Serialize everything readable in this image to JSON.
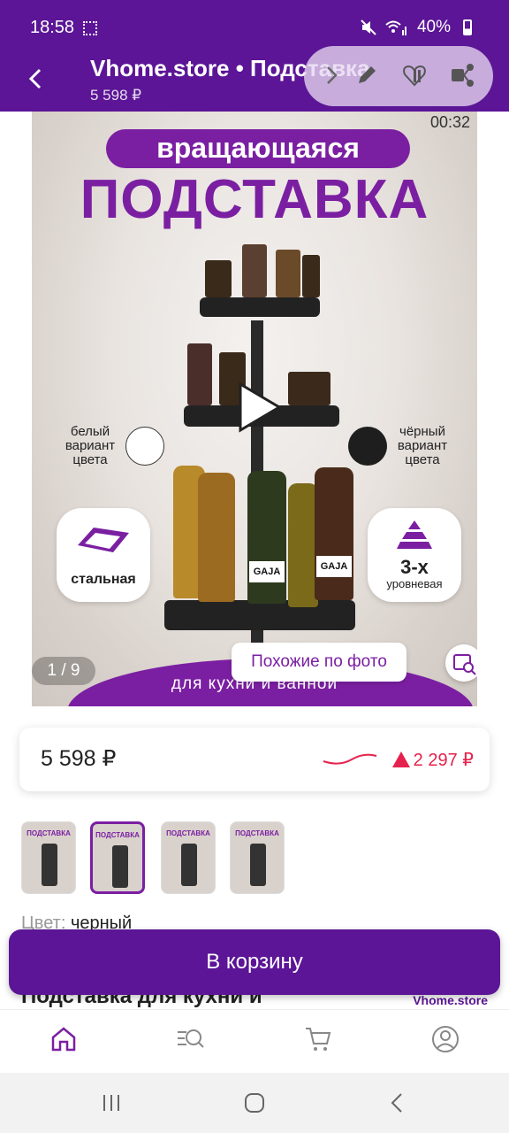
{
  "status": {
    "time": "18:58",
    "battery": "40%"
  },
  "header": {
    "title": "Vhome.store • Подставка для кухни и ванной",
    "price": "5 598 ₽"
  },
  "media": {
    "timer": "00:32",
    "pill_text": "вращающаяся",
    "big_title": "ПОДСТАВКА",
    "white_variant": "белый вариант цвета",
    "black_variant": "чёрный вариант цвета",
    "badge_left": "стальная",
    "badge_right_top": "3-х",
    "badge_right_bottom": "уровневая",
    "counter": "1 / 9",
    "bottom_text": "для кухни и ванной",
    "similar": "Похожие по фото",
    "bottle_label": "GAJA"
  },
  "price_card": {
    "current": "5 598 ₽",
    "delta": "2 297 ₽"
  },
  "thumbnails": [
    {
      "title": "ПОДСТАВКА"
    },
    {
      "title": "ПОДСТАВКА"
    },
    {
      "title": "ПОДСТАВКА"
    },
    {
      "title": "ПОДСТАВКА"
    }
  ],
  "product": {
    "color_label": "Цвет:",
    "color_value": "черный",
    "name": "Подставка для кухни и",
    "seller": "Vhome.store"
  },
  "actions": {
    "cart": "В корзину"
  },
  "colors": {
    "brand": "#5b1596",
    "accent": "#7b1fa2",
    "price_up": "#e5224d"
  }
}
